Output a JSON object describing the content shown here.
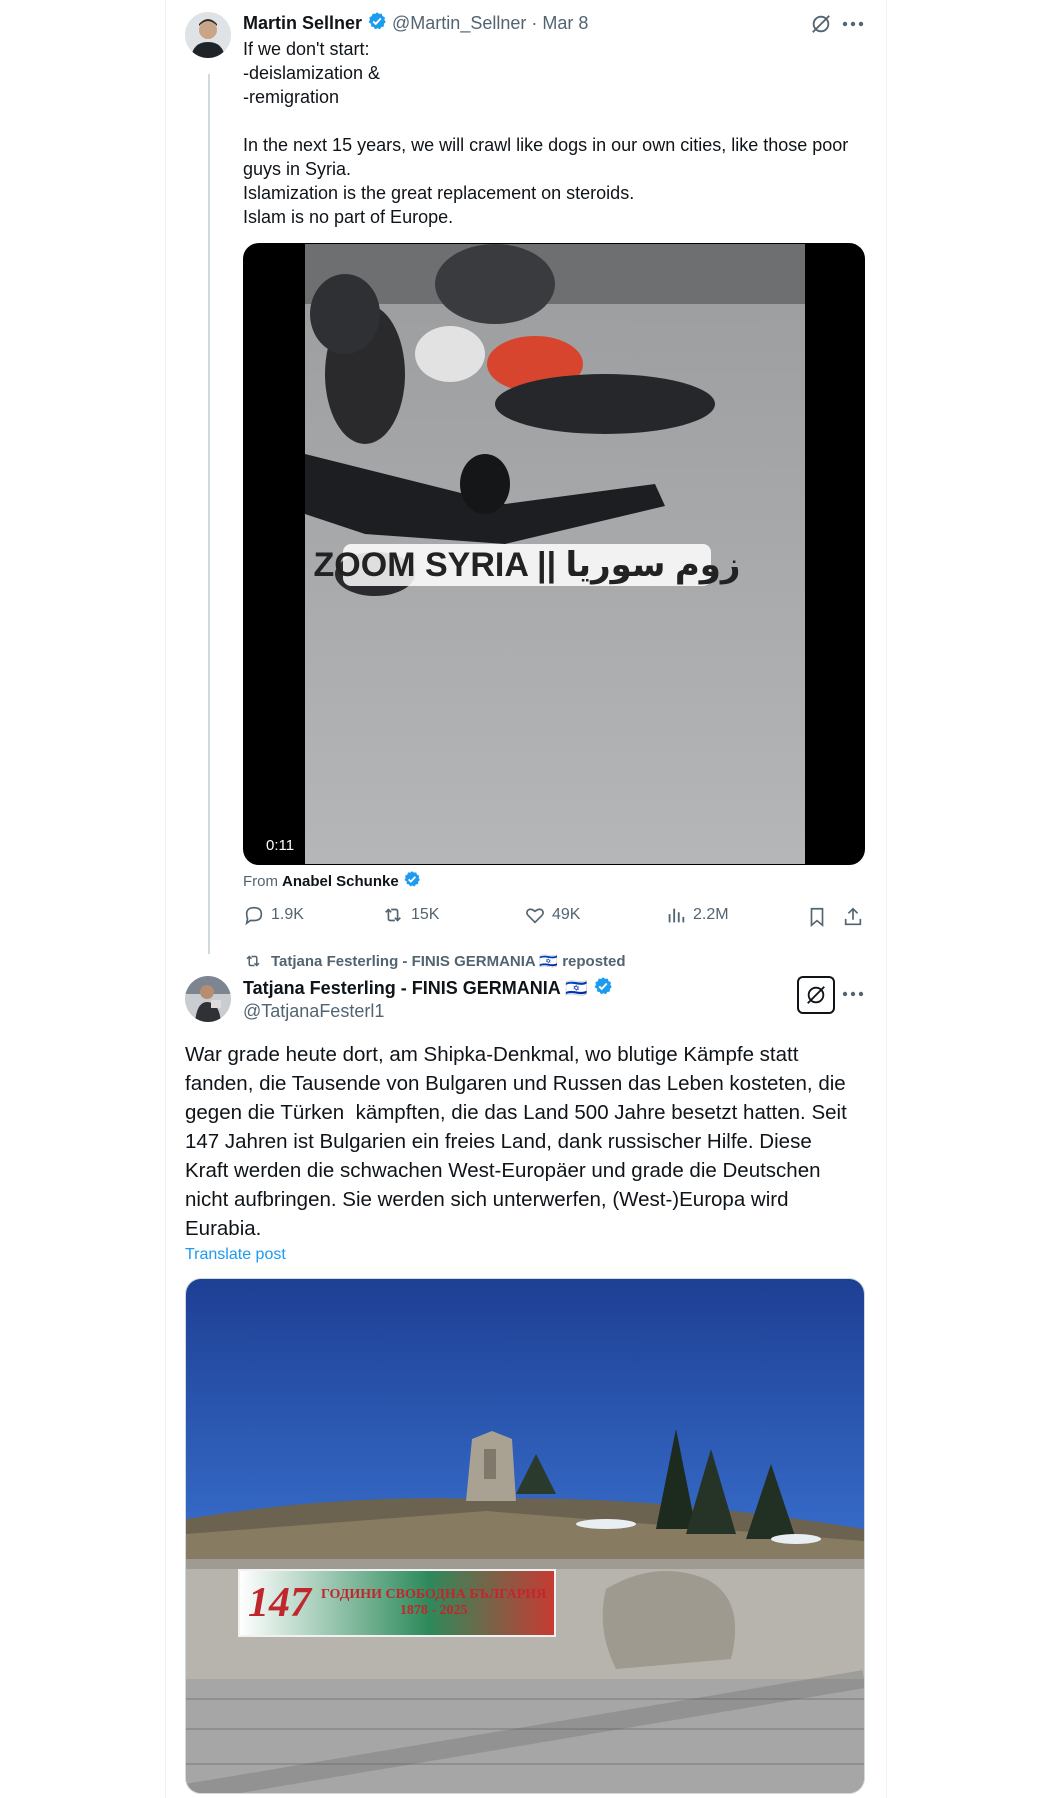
{
  "post1": {
    "author_name": "Martin Sellner",
    "handle": "@Martin_Sellner",
    "separator": "·",
    "date": "Mar 8",
    "text_lines": [
      "If we don't start:",
      "-deislamization &",
      "-remigration",
      "",
      "In the next 15 years, we will crawl like dogs in our own cities, like those poor",
      "guys in Syria.",
      "Islamization is the great replacement on steroids.",
      "Islam is no part of Europe."
    ],
    "video": {
      "overlay_caption": "ZOOM SYRIA || زوم سوريا",
      "duration": "0:11"
    },
    "from_label": "From",
    "from_author": "Anabel Schunke",
    "actions": {
      "replies": "1.9K",
      "reposts": "15K",
      "likes": "49K",
      "views": "2.2M"
    }
  },
  "repost_header": {
    "text": "Tatjana Festerling - FINIS GERMANIA 🇮🇱 reposted"
  },
  "post2": {
    "author_name": "Tatjana Festerling - FINIS GERMANIA 🇮🇱",
    "handle": "@TatjanaFesterl1",
    "text_lines": [
      "War grade heute dort, am Shipka-Denkmal, wo blutige Kämpfe statt",
      "fanden, die Tausende von Bulgaren und Russen das Leben kosteten, die",
      "gegen die Türken  kämpften, die das Land 500 Jahre besetzt hatten. Seit",
      "147 Jahren ist Bulgarien ein freies Land, dank russischer Hilfe. Diese",
      "Kraft werden die schwachen West-Europäer und grade die Deutschen",
      "nicht aufbringen. Sie werden sich unterwerfen, (West-)Europa wird",
      "Eurabia."
    ],
    "translate_link": "Translate post",
    "image": {
      "banner_number": "147",
      "banner_title": "ГОДИНИ СВОБОДНА БЪЛГАРИЯ",
      "banner_years": "1878 - 2025"
    }
  },
  "colors": {
    "accent_blue": "#1d9bf0",
    "text_primary": "#0f1419",
    "text_secondary": "#536471"
  },
  "icons": [
    "grok-icon",
    "more-icon",
    "verified-badge-icon",
    "reply-icon",
    "repost-icon",
    "like-icon",
    "views-icon",
    "bookmark-icon",
    "share-icon"
  ]
}
